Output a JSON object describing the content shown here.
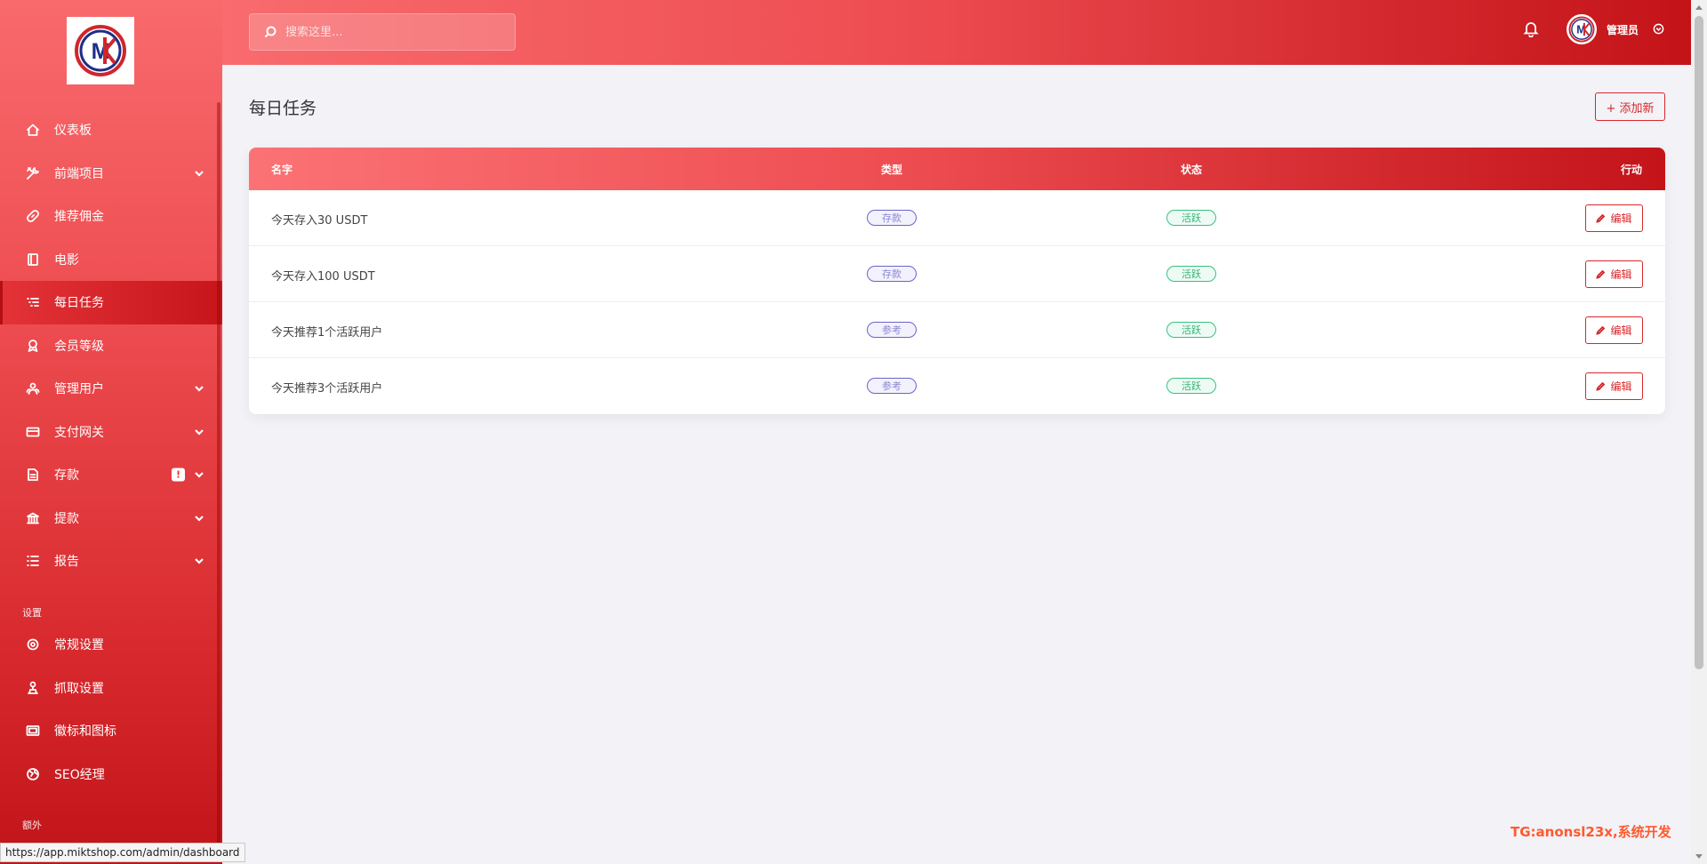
{
  "brand": {
    "logo_text": "MK"
  },
  "search": {
    "placeholder": "搜索这里..."
  },
  "user": {
    "name": "管理员"
  },
  "sidebar": {
    "items": [
      {
        "label": "仪表板",
        "icon": "home-icon"
      },
      {
        "label": "前端项目",
        "icon": "tools-icon",
        "has_children": true
      },
      {
        "label": "推荐佣金",
        "icon": "link-icon"
      },
      {
        "label": "电影",
        "icon": "film-icon"
      },
      {
        "label": "每日任务",
        "icon": "list-icon",
        "active": true
      },
      {
        "label": "会员等级",
        "icon": "award-icon"
      },
      {
        "label": "管理用户",
        "icon": "users-icon",
        "has_children": true
      },
      {
        "label": "支付网关",
        "icon": "card-icon",
        "has_children": true
      },
      {
        "label": "存款",
        "icon": "deposit-icon",
        "has_children": true,
        "badge": "!"
      },
      {
        "label": "提款",
        "icon": "bank-icon",
        "has_children": true
      },
      {
        "label": "报告",
        "icon": "report-icon",
        "has_children": true
      }
    ],
    "section_settings": "设置",
    "settings_items": [
      {
        "label": "常规设置",
        "icon": "settings-icon"
      },
      {
        "label": "抓取设置",
        "icon": "crawl-icon"
      },
      {
        "label": "徽标和图标",
        "icon": "image-icon"
      },
      {
        "label": "SEO经理",
        "icon": "globe-icon"
      }
    ],
    "section_extra": "额外"
  },
  "page": {
    "title": "每日任务",
    "add_button": "+ 添加新"
  },
  "table": {
    "headers": {
      "name": "名字",
      "type": "类型",
      "status": "状态",
      "action": "行动"
    },
    "rows": [
      {
        "name": "今天存入30 USDT",
        "type": "存款",
        "status": "活跃",
        "action": "编辑"
      },
      {
        "name": "今天存入100 USDT",
        "type": "存款",
        "status": "活跃",
        "action": "编辑"
      },
      {
        "name": "今天推荐1个活跃用户",
        "type": "参考",
        "status": "活跃",
        "action": "编辑"
      },
      {
        "name": "今天推荐3个活跃用户",
        "type": "参考",
        "status": "活跃",
        "action": "编辑"
      }
    ]
  },
  "watermark": "TG:anonsl23x,系统开发",
  "status_bar_url": "https://app.miktshop.com/admin/dashboard",
  "colors": {
    "accent": "#d9262b",
    "gradient_light": "#f86b6e",
    "gradient_dark": "#c31318",
    "type_pill": "#6a64c8",
    "status_pill": "#34c47c"
  }
}
